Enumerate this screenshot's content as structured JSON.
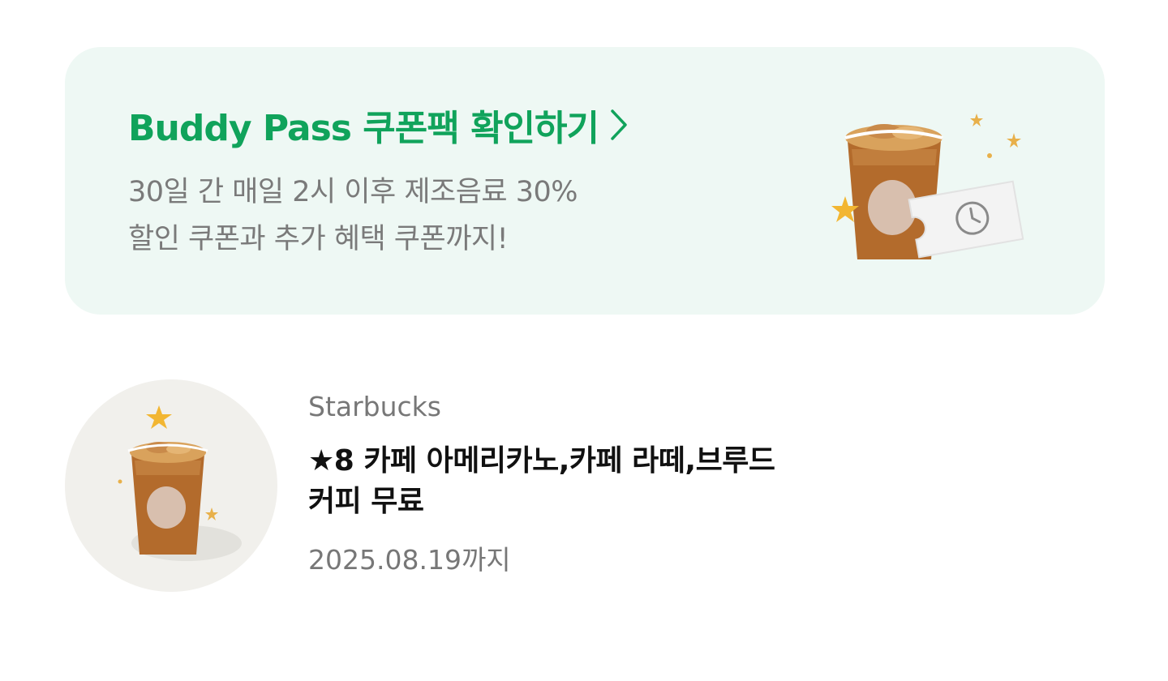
{
  "banner": {
    "title": "Buddy Pass 쿠폰팩 확인하기",
    "desc_line1": "30일 간 매일 2시 이후 제조음료 30%",
    "desc_line2": "할인 쿠폰과 추가 혜택 쿠폰까지!",
    "icons": [
      "chevron-right-icon",
      "iced-coffee-ticket-illustration",
      "star-icon",
      "clock-icon"
    ],
    "colors": {
      "accent": "#10a35b",
      "background": "#eef8f4",
      "star": "#f2b632",
      "cup": "#b36b2c"
    }
  },
  "coupon": {
    "brand": "Starbucks",
    "name_line1": "★8 카페 아메리카노,카페 라떼,브루드",
    "name_line2": "커피 무료",
    "expiry": "2025.08.19까지",
    "icons": [
      "iced-coffee-illustration",
      "star-icon"
    ]
  }
}
